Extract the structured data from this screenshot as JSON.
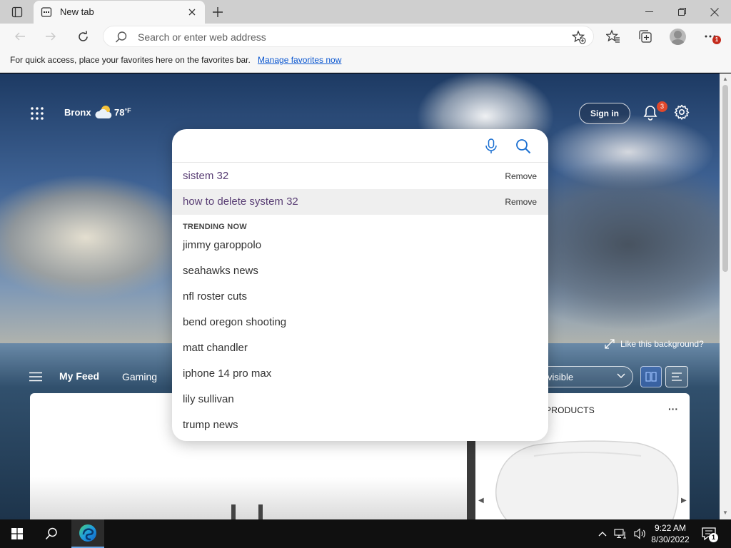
{
  "browser": {
    "tab_title": "New tab",
    "address_placeholder": "Search or enter web address",
    "more_badge": "1"
  },
  "favorites_bar": {
    "message": "For quick access, place your favorites here on the favorites bar.",
    "link": "Manage favorites now"
  },
  "newtab": {
    "weather": {
      "location": "Bronx",
      "temperature": "78",
      "unit": "°F",
      "icon": "partly-cloudy-icon"
    },
    "sign_in": "Sign in",
    "notifications_count": "3",
    "like_background": "Like this background?",
    "feed_nav": {
      "my_feed": "My Feed",
      "gaming": "Gaming",
      "visibility_select": "ly visible"
    },
    "side_card": {
      "title": "PRODUCTS",
      "more": "···"
    }
  },
  "search": {
    "query": "",
    "history": [
      {
        "text": "sistem 32",
        "remove": "Remove"
      },
      {
        "text": "how to delete system 32",
        "remove": "Remove"
      }
    ],
    "trending_header": "TRENDING NOW",
    "trending": [
      "jimmy garoppolo",
      "seahawks news",
      "nfl roster cuts",
      "bend oregon shooting",
      "matt chandler",
      "iphone 14 pro max",
      "lily sullivan",
      "trump news"
    ]
  },
  "taskbar": {
    "time": "9:22 AM",
    "date": "8/30/2022",
    "notification_count": "1"
  },
  "colors": {
    "accent": "#0b57d0",
    "badge_red": "#e0482c",
    "history_text": "#5a3f75"
  }
}
